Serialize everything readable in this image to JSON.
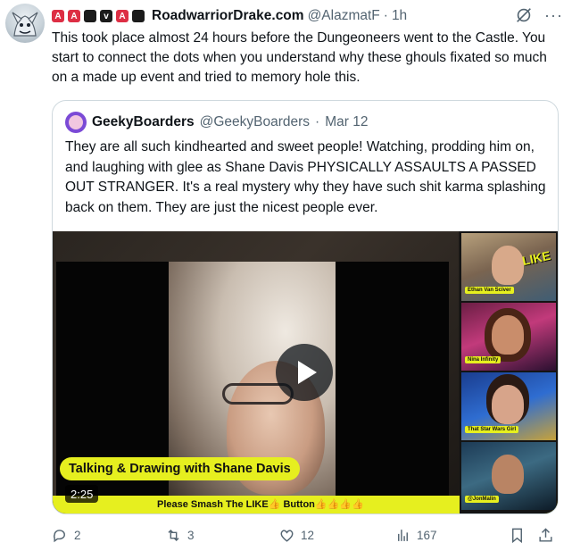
{
  "tweet": {
    "display_name": "RoadwarriorDrake.com",
    "badges": [
      "A",
      "A",
      "v",
      "A"
    ],
    "handle": "@AlazmatF",
    "separator": "·",
    "time": "1h",
    "text": "This took place almost 24 hours before the Dungeoneers went to the Castle. You start to connect the dots when you understand why these ghouls fixated so much on a made up event and tried to memory hole this."
  },
  "quote": {
    "display_name": "GeekyBoarders",
    "handle": "@GeekyBoarders",
    "separator": "·",
    "date": "Mar 12",
    "text": "They are all such kindhearted and sweet people! Watching, prodding him on, and laughing with glee as Shane Davis PHYSICALLY ASSAULTS A PASSED OUT STRANGER. It's a real mystery why they have such shit karma splashing back on them. They are just the nicest people ever.",
    "media": {
      "show_title": "Talking & Drawing with Shane Davis",
      "duration": "2:25",
      "banner": "Please Smash The LIKE👍 Button👍👍👍👍",
      "like_logo": "LIKE",
      "cams": [
        "Ethan Van Sciver",
        "Nina Infinity",
        "That Star Wars Girl",
        "@JonMalin"
      ]
    }
  },
  "actions": {
    "replies": "2",
    "reposts": "3",
    "likes": "12",
    "views": "167"
  },
  "colors": {
    "accent_yellow": "#e6ef1f",
    "badge_red": "#dd2e44",
    "muted_text": "#536471"
  }
}
